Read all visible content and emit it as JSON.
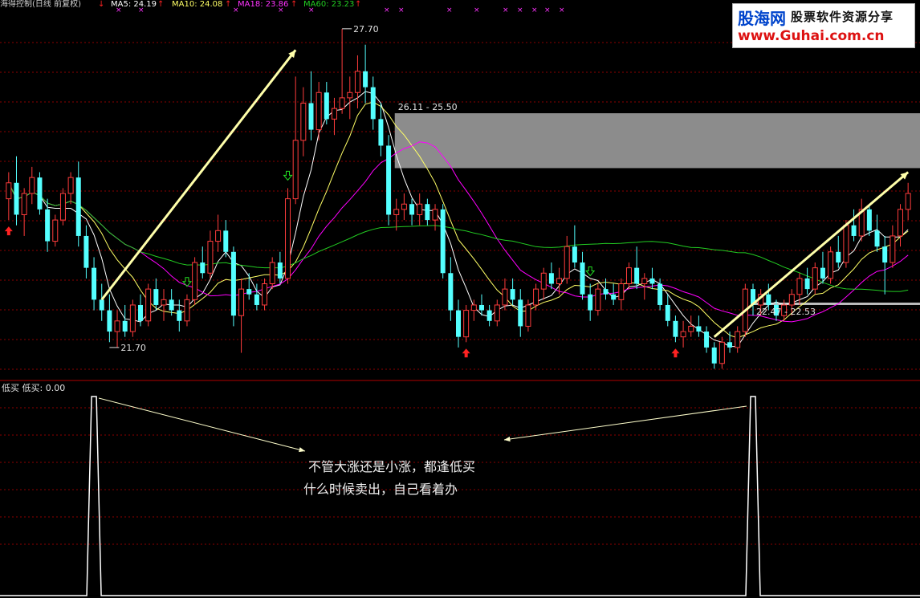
{
  "header": {
    "title": "海得控制(日线 前复权)",
    "ma5": "MA5: 24.19",
    "ma10": "MA10: 24.08",
    "ma18": "MA18: 23.86",
    "ma60": "MA60: 23.23",
    "arrow_glyph": "↑",
    "arrow_left_glyph": "↓"
  },
  "watermark": {
    "logo": "股海网",
    "tagline": "股票软件资源分享",
    "url": "www.Guhai.com.cn"
  },
  "annotations": {
    "high_label": "27.70",
    "low_label": "21.70",
    "box_upper_label": "26.11 - 25.50",
    "box_lower_label": "22.47 - 22.53"
  },
  "lower_panel": {
    "title": "低买  低买: 0.00",
    "note_line1": "不管大涨还是小涨，都逢低买",
    "note_line2": "什么时候卖出，自己看着办"
  },
  "colors": {
    "up": "#ff3c3c",
    "down": "#54ffff",
    "ma5": "#ffffff",
    "ma10": "#ffff66",
    "ma18": "#ff00ff",
    "ma60": "#22cc22",
    "grid": "#8b0000",
    "signal_up": "#ff2222",
    "signal_down": "#22dd22",
    "trend_arrow": "#ffffaa",
    "watermark_blue": "#0044cc",
    "watermark_red": "#dd1111"
  },
  "chart_data": {
    "type": "candlestick",
    "price_range": [
      21.2,
      28.0
    ],
    "candles": [
      {
        "o": 24.5,
        "h": 25.0,
        "l": 24.1,
        "c": 24.8
      },
      {
        "o": 24.8,
        "h": 25.3,
        "l": 24.0,
        "c": 24.2
      },
      {
        "o": 24.2,
        "h": 24.7,
        "l": 23.8,
        "c": 24.6
      },
      {
        "o": 24.6,
        "h": 25.1,
        "l": 24.4,
        "c": 24.9
      },
      {
        "o": 24.9,
        "h": 25.0,
        "l": 24.2,
        "c": 24.3
      },
      {
        "o": 24.3,
        "h": 24.5,
        "l": 23.5,
        "c": 23.7
      },
      {
        "o": 23.7,
        "h": 24.2,
        "l": 23.6,
        "c": 24.1
      },
      {
        "o": 24.1,
        "h": 24.7,
        "l": 24.0,
        "c": 24.6
      },
      {
        "o": 24.6,
        "h": 25.0,
        "l": 24.4,
        "c": 24.9
      },
      {
        "o": 24.9,
        "h": 25.2,
        "l": 23.6,
        "c": 23.8
      },
      {
        "o": 23.8,
        "h": 24.0,
        "l": 23.0,
        "c": 23.2
      },
      {
        "o": 23.2,
        "h": 23.4,
        "l": 22.4,
        "c": 22.6
      },
      {
        "o": 22.6,
        "h": 22.9,
        "l": 22.2,
        "c": 22.4
      },
      {
        "o": 22.4,
        "h": 22.7,
        "l": 21.8,
        "c": 22.0
      },
      {
        "o": 22.0,
        "h": 22.4,
        "l": 21.7,
        "c": 22.2
      },
      {
        "o": 22.2,
        "h": 22.5,
        "l": 21.9,
        "c": 22.0
      },
      {
        "o": 22.0,
        "h": 22.6,
        "l": 21.9,
        "c": 22.5
      },
      {
        "o": 22.5,
        "h": 22.7,
        "l": 22.1,
        "c": 22.2
      },
      {
        "o": 22.2,
        "h": 22.9,
        "l": 22.1,
        "c": 22.8
      },
      {
        "o": 22.8,
        "h": 23.0,
        "l": 22.4,
        "c": 22.5
      },
      {
        "o": 22.5,
        "h": 22.8,
        "l": 22.2,
        "c": 22.6
      },
      {
        "o": 22.6,
        "h": 22.8,
        "l": 22.3,
        "c": 22.4
      },
      {
        "o": 22.4,
        "h": 22.6,
        "l": 22.0,
        "c": 22.2
      },
      {
        "o": 22.2,
        "h": 22.7,
        "l": 22.1,
        "c": 22.6
      },
      {
        "o": 22.6,
        "h": 23.4,
        "l": 22.5,
        "c": 23.3
      },
      {
        "o": 23.3,
        "h": 23.6,
        "l": 23.0,
        "c": 23.1
      },
      {
        "o": 23.1,
        "h": 23.9,
        "l": 23.0,
        "c": 23.7
      },
      {
        "o": 23.7,
        "h": 24.2,
        "l": 23.5,
        "c": 23.9
      },
      {
        "o": 23.9,
        "h": 24.1,
        "l": 23.4,
        "c": 23.5
      },
      {
        "o": 23.5,
        "h": 23.6,
        "l": 22.1,
        "c": 22.3
      },
      {
        "o": 22.3,
        "h": 23.0,
        "l": 21.6,
        "c": 22.8
      },
      {
        "o": 22.8,
        "h": 23.1,
        "l": 22.6,
        "c": 22.7
      },
      {
        "o": 22.7,
        "h": 22.9,
        "l": 22.4,
        "c": 22.5
      },
      {
        "o": 22.5,
        "h": 23.0,
        "l": 22.4,
        "c": 22.9
      },
      {
        "o": 22.9,
        "h": 23.4,
        "l": 22.8,
        "c": 23.3
      },
      {
        "o": 23.3,
        "h": 23.5,
        "l": 22.9,
        "c": 23.0
      },
      {
        "o": 23.0,
        "h": 24.7,
        "l": 22.9,
        "c": 24.5
      },
      {
        "o": 24.5,
        "h": 26.8,
        "l": 24.4,
        "c": 25.6
      },
      {
        "o": 25.6,
        "h": 26.6,
        "l": 25.3,
        "c": 26.3
      },
      {
        "o": 26.3,
        "h": 26.9,
        "l": 25.6,
        "c": 25.8
      },
      {
        "o": 25.8,
        "h": 26.7,
        "l": 25.6,
        "c": 26.5
      },
      {
        "o": 26.5,
        "h": 26.7,
        "l": 25.9,
        "c": 26.0
      },
      {
        "o": 26.0,
        "h": 26.4,
        "l": 25.7,
        "c": 26.2
      },
      {
        "o": 26.2,
        "h": 27.7,
        "l": 26.1,
        "c": 26.4
      },
      {
        "o": 26.4,
        "h": 26.8,
        "l": 26.0,
        "c": 26.5
      },
      {
        "o": 26.5,
        "h": 27.2,
        "l": 26.2,
        "c": 26.9
      },
      {
        "o": 26.9,
        "h": 27.4,
        "l": 26.3,
        "c": 26.6
      },
      {
        "o": 26.6,
        "h": 26.8,
        "l": 25.8,
        "c": 26.0
      },
      {
        "o": 26.0,
        "h": 26.3,
        "l": 25.3,
        "c": 25.5
      },
      {
        "o": 25.5,
        "h": 25.7,
        "l": 24.0,
        "c": 24.2
      },
      {
        "o": 24.2,
        "h": 24.5,
        "l": 23.9,
        "c": 24.3
      },
      {
        "o": 24.3,
        "h": 24.6,
        "l": 24.1,
        "c": 24.4
      },
      {
        "o": 24.4,
        "h": 24.5,
        "l": 24.0,
        "c": 24.2
      },
      {
        "o": 24.2,
        "h": 24.6,
        "l": 24.0,
        "c": 24.4
      },
      {
        "o": 24.4,
        "h": 24.5,
        "l": 24.0,
        "c": 24.1
      },
      {
        "o": 24.1,
        "h": 24.4,
        "l": 23.9,
        "c": 24.3
      },
      {
        "o": 24.3,
        "h": 24.4,
        "l": 23.0,
        "c": 23.1
      },
      {
        "o": 23.1,
        "h": 23.4,
        "l": 22.2,
        "c": 22.4
      },
      {
        "o": 22.4,
        "h": 22.6,
        "l": 21.7,
        "c": 21.9
      },
      {
        "o": 21.9,
        "h": 22.5,
        "l": 21.8,
        "c": 22.4
      },
      {
        "o": 22.4,
        "h": 22.6,
        "l": 22.2,
        "c": 22.5
      },
      {
        "o": 22.5,
        "h": 22.7,
        "l": 22.3,
        "c": 22.4
      },
      {
        "o": 22.4,
        "h": 22.5,
        "l": 22.1,
        "c": 22.2
      },
      {
        "o": 22.2,
        "h": 22.6,
        "l": 22.1,
        "c": 22.5
      },
      {
        "o": 22.5,
        "h": 23.0,
        "l": 22.4,
        "c": 22.8
      },
      {
        "o": 22.8,
        "h": 23.0,
        "l": 22.5,
        "c": 22.6
      },
      {
        "o": 22.6,
        "h": 22.8,
        "l": 21.9,
        "c": 22.1
      },
      {
        "o": 22.1,
        "h": 22.6,
        "l": 22.0,
        "c": 22.5
      },
      {
        "o": 22.5,
        "h": 22.9,
        "l": 22.4,
        "c": 22.8
      },
      {
        "o": 22.8,
        "h": 23.2,
        "l": 22.6,
        "c": 23.1
      },
      {
        "o": 23.1,
        "h": 23.3,
        "l": 22.8,
        "c": 22.9
      },
      {
        "o": 22.9,
        "h": 23.2,
        "l": 22.7,
        "c": 23.0
      },
      {
        "o": 23.0,
        "h": 23.8,
        "l": 22.9,
        "c": 23.6
      },
      {
        "o": 23.6,
        "h": 24.0,
        "l": 23.2,
        "c": 23.3
      },
      {
        "o": 23.3,
        "h": 23.5,
        "l": 22.6,
        "c": 22.7
      },
      {
        "o": 22.7,
        "h": 22.9,
        "l": 22.2,
        "c": 22.4
      },
      {
        "o": 22.4,
        "h": 22.9,
        "l": 22.3,
        "c": 22.8
      },
      {
        "o": 22.8,
        "h": 23.0,
        "l": 22.6,
        "c": 22.7
      },
      {
        "o": 22.7,
        "h": 22.9,
        "l": 22.5,
        "c": 22.6
      },
      {
        "o": 22.6,
        "h": 23.0,
        "l": 22.4,
        "c": 22.9
      },
      {
        "o": 22.9,
        "h": 23.3,
        "l": 22.8,
        "c": 23.2
      },
      {
        "o": 23.2,
        "h": 23.6,
        "l": 22.8,
        "c": 22.9
      },
      {
        "o": 22.9,
        "h": 23.1,
        "l": 22.6,
        "c": 23.0
      },
      {
        "o": 23.0,
        "h": 23.2,
        "l": 22.8,
        "c": 22.9
      },
      {
        "o": 22.9,
        "h": 23.0,
        "l": 22.4,
        "c": 22.5
      },
      {
        "o": 22.5,
        "h": 22.7,
        "l": 22.1,
        "c": 22.2
      },
      {
        "o": 22.2,
        "h": 22.3,
        "l": 21.8,
        "c": 21.9
      },
      {
        "o": 21.9,
        "h": 22.2,
        "l": 21.7,
        "c": 22.0
      },
      {
        "o": 22.0,
        "h": 22.3,
        "l": 21.9,
        "c": 22.1
      },
      {
        "o": 22.1,
        "h": 22.3,
        "l": 21.9,
        "c": 22.0
      },
      {
        "o": 22.0,
        "h": 22.1,
        "l": 21.6,
        "c": 21.7
      },
      {
        "o": 21.7,
        "h": 21.8,
        "l": 21.3,
        "c": 21.4
      },
      {
        "o": 21.4,
        "h": 21.9,
        "l": 21.3,
        "c": 21.8
      },
      {
        "o": 21.8,
        "h": 22.0,
        "l": 21.6,
        "c": 21.7
      },
      {
        "o": 21.7,
        "h": 22.1,
        "l": 21.6,
        "c": 22.0
      },
      {
        "o": 22.0,
        "h": 22.9,
        "l": 21.9,
        "c": 22.8
      },
      {
        "o": 22.8,
        "h": 22.9,
        "l": 22.3,
        "c": 22.5
      },
      {
        "o": 22.5,
        "h": 22.8,
        "l": 22.3,
        "c": 22.7
      },
      {
        "o": 22.7,
        "h": 22.9,
        "l": 22.4,
        "c": 22.5
      },
      {
        "o": 22.5,
        "h": 22.6,
        "l": 22.2,
        "c": 22.3
      },
      {
        "o": 22.3,
        "h": 22.6,
        "l": 22.2,
        "c": 22.5
      },
      {
        "o": 22.5,
        "h": 22.8,
        "l": 22.3,
        "c": 22.7
      },
      {
        "o": 22.7,
        "h": 23.1,
        "l": 22.5,
        "c": 23.0
      },
      {
        "o": 23.0,
        "h": 23.2,
        "l": 22.7,
        "c": 22.8
      },
      {
        "o": 22.8,
        "h": 23.3,
        "l": 22.7,
        "c": 23.2
      },
      {
        "o": 23.2,
        "h": 23.5,
        "l": 22.9,
        "c": 23.0
      },
      {
        "o": 23.0,
        "h": 23.6,
        "l": 22.9,
        "c": 23.5
      },
      {
        "o": 23.5,
        "h": 23.8,
        "l": 23.2,
        "c": 23.3
      },
      {
        "o": 23.3,
        "h": 24.1,
        "l": 23.2,
        "c": 24.0
      },
      {
        "o": 24.0,
        "h": 24.3,
        "l": 23.7,
        "c": 23.8
      },
      {
        "o": 23.8,
        "h": 24.5,
        "l": 23.7,
        "c": 24.3
      },
      {
        "o": 24.3,
        "h": 24.4,
        "l": 23.8,
        "c": 23.9
      },
      {
        "o": 23.9,
        "h": 24.2,
        "l": 23.5,
        "c": 23.6
      },
      {
        "o": 23.6,
        "h": 23.8,
        "l": 22.7,
        "c": 23.3
      },
      {
        "o": 23.3,
        "h": 24.0,
        "l": 23.2,
        "c": 23.8
      },
      {
        "o": 23.8,
        "h": 24.4,
        "l": 23.6,
        "c": 24.3
      },
      {
        "o": 24.3,
        "h": 24.8,
        "l": 24.1,
        "c": 24.6
      }
    ],
    "signals_up": [
      0,
      59,
      86
    ],
    "signals_down": [
      36,
      23,
      75
    ],
    "lower_panel": {
      "range": [
        0,
        1
      ],
      "spikes": [
        11,
        96
      ]
    }
  }
}
